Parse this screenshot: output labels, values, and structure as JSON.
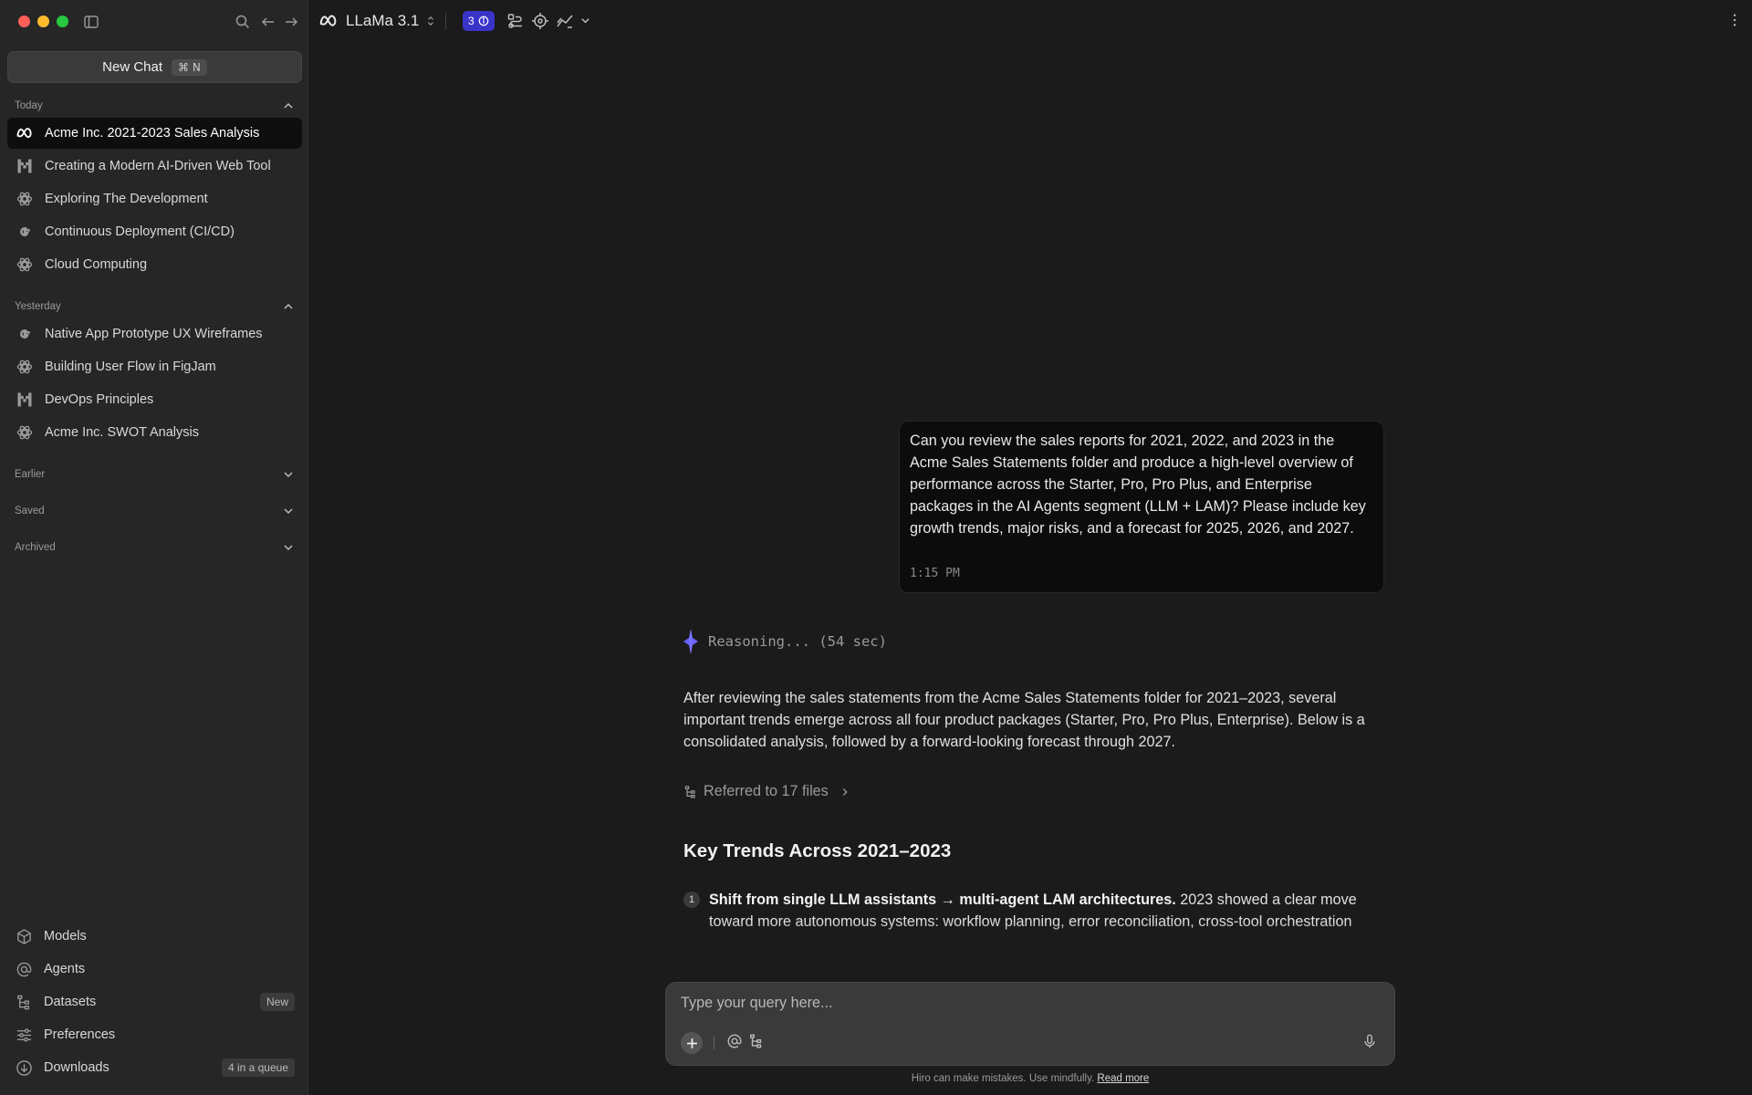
{
  "sidebar": {
    "new_chat_label": "New Chat",
    "new_chat_shortcut": "⌘ N",
    "sections": {
      "today": "Today",
      "yesterday": "Yesterday",
      "earlier": "Earlier",
      "saved": "Saved",
      "archived": "Archived"
    },
    "today_items": [
      {
        "label": "Acme Inc. 2021-2023 Sales Analysis",
        "icon": "meta-icon"
      },
      {
        "label": "Creating a Modern AI-Driven Web Tool",
        "icon": "mistral-icon"
      },
      {
        "label": "Exploring The Development",
        "icon": "openai-icon"
      },
      {
        "label": "Continuous Deployment (CI/CD)",
        "icon": "google-icon"
      },
      {
        "label": "Cloud Computing",
        "icon": "openai-icon"
      }
    ],
    "yesterday_items": [
      {
        "label": "Native App Prototype UX Wireframes",
        "icon": "google-icon"
      },
      {
        "label": "Building User Flow in FigJam",
        "icon": "openai-icon"
      },
      {
        "label": "DevOps Principles",
        "icon": "mistral-icon"
      },
      {
        "label": "Acme Inc. SWOT Analysis",
        "icon": "openai-icon"
      }
    ],
    "bottom": {
      "models": "Models",
      "agents": "Agents",
      "datasets": "Datasets",
      "datasets_badge": "New",
      "preferences": "Preferences",
      "downloads": "Downloads",
      "downloads_badge": "4 in a queue"
    }
  },
  "topbar": {
    "model_name": "LLaMa 3.1",
    "badge_count": "3"
  },
  "conversation": {
    "user_message": "Can you review the sales reports for 2021, 2022, and 2023 in the Acme Sales Statements folder and produce a high-level overview of performance across the Starter, Pro, Pro Plus, and Enterprise packages in the AI Agents segment (LLM + LAM)? Please include key growth trends, major risks, and a forecast for 2025, 2026, and 2027.",
    "user_time": "1:15 PM",
    "reasoning": "Reasoning... (54 sec)",
    "answer_intro": "After reviewing the sales statements from the Acme Sales Statements folder for 2021–2023, several important trends emerge across all four product packages (Starter, Pro, Pro Plus, Enterprise). Below is a consolidated analysis, followed by a forward-looking forecast through 2027.",
    "referred": "Referred to 17 files",
    "heading": "Key Trends Across 2021–2023",
    "item1_num": "1",
    "item1_bold": "Shift from single LLM assistants → multi-agent LAM architectures.",
    "item1_text": " 2023 showed a clear move toward more autonomous systems: workflow planning, error reconciliation, cross-tool orchestration"
  },
  "composer": {
    "placeholder": "Type your query here...",
    "disclaimer": "Hiro can make mistakes. Use mindfully.",
    "read_more": "Read more"
  },
  "colors": {
    "accent": "#3b34c9",
    "reasoning_spark": "#6c63ff",
    "active_item_bg": "#0e0e0e"
  }
}
